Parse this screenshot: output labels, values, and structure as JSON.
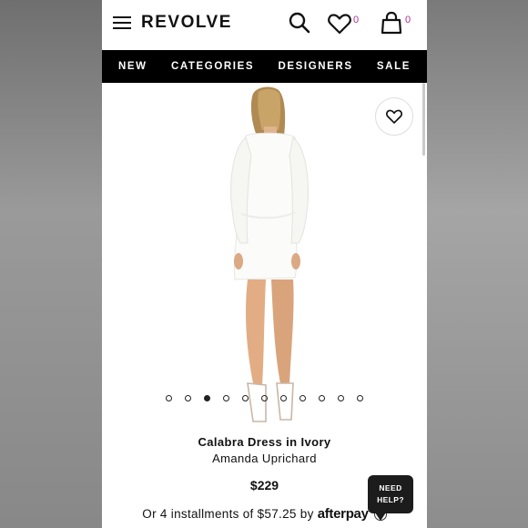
{
  "header": {
    "logo": "REVOLVE",
    "wishlist_count": "0",
    "bag_count": "0",
    "icons": [
      "menu-icon",
      "search-icon",
      "heart-icon",
      "bag-icon"
    ]
  },
  "nav": {
    "items": [
      {
        "label": "NEW"
      },
      {
        "label": "CATEGORIES"
      },
      {
        "label": "DESIGNERS"
      },
      {
        "label": "SALE"
      }
    ]
  },
  "gallery": {
    "image_count": 11,
    "active_index": 2
  },
  "product": {
    "name": "Calabra Dress in Ivory",
    "brand": "Amanda Uprichard",
    "price": "$229",
    "installments_text": "Or 4 installments of $57.25 by",
    "provider": "afterpay"
  },
  "help": {
    "line1": "NEED",
    "line2": "HELP?"
  },
  "colors": {
    "nav_bg": "#000000",
    "badge": "#b0308f",
    "help_bg": "#1c1c1c"
  }
}
